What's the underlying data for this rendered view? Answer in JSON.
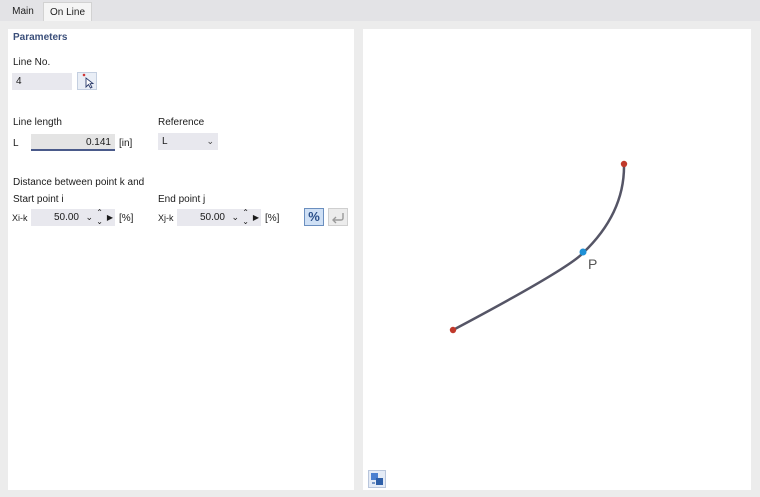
{
  "tabs": [
    {
      "label": "Main"
    },
    {
      "label": "On Line"
    }
  ],
  "parameters": {
    "title": "Parameters",
    "line_no_label": "Line No.",
    "line_no_value": "4",
    "line_length_label": "Line length",
    "length_symbol": "L",
    "length_value": "0.141",
    "length_unit": "[in]",
    "reference_label": "Reference",
    "reference_value": "L",
    "distance_label": "Distance between point k and",
    "start_label": "Start point i",
    "start_symbol": "Xi-k",
    "start_value": "50.00",
    "start_unit": "[%]",
    "end_label": "End point j",
    "end_symbol": "Xj-k",
    "end_value": "50.00",
    "end_unit": "[%]",
    "percent_button": "%"
  },
  "preview": {
    "point_label": "P"
  },
  "colors": {
    "accent": "#4a5a8a",
    "endpoint": "#c0392b",
    "point_p": "#1e90d6",
    "curve": "#555566"
  }
}
